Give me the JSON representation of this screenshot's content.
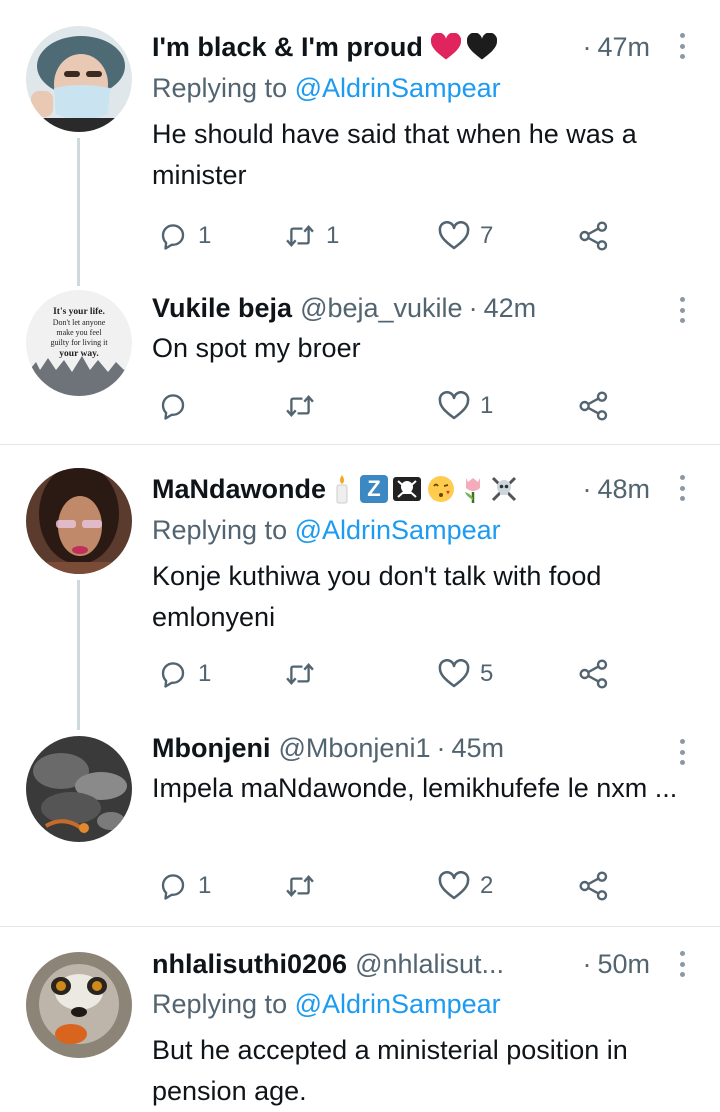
{
  "tweets": [
    {
      "name": "I'm black & I'm proud",
      "handle": "",
      "time": "47m",
      "replying_label": "Replying to",
      "replying_to": "@AldrinSampear",
      "text": "He should have said that when he was a minister",
      "replies": "1",
      "retweets": "1",
      "likes": "7"
    },
    {
      "name": "Vukile beja",
      "handle": "@beja_vukile",
      "time": "42m",
      "text": "On spot my broer",
      "replies": "",
      "retweets": "",
      "likes": "1",
      "avatar_text": [
        "It's your life.",
        "Don't let anyone",
        "make you feel",
        "guilty for living it",
        "your way."
      ]
    },
    {
      "name": "MaNdawonde",
      "handle": "",
      "time": "48m",
      "badge_letter": "Z",
      "replying_label": "Replying to",
      "replying_to": "@AldrinSampear",
      "text": "Konje kuthiwa you don't talk with food emlonyeni",
      "replies": "1",
      "retweets": "",
      "likes": "5"
    },
    {
      "name": "Mbonjeni",
      "handle": "@Mbonjeni1",
      "time": "45m",
      "text": "Impela maNdawonde, lemikhufefe le nxm ...",
      "replies": "1",
      "retweets": "",
      "likes": "2"
    },
    {
      "name": "nhlalisuthi0206",
      "handle": "@nhlalisut...",
      "time": "50m",
      "replying_label": "Replying to",
      "replying_to": "@AldrinSampear",
      "text": "But he accepted a ministerial position in pension age."
    }
  ],
  "dot_separator": "·",
  "icons": [
    "reply-icon",
    "retweet-icon",
    "like-icon",
    "share-icon",
    "more-icon"
  ],
  "colors": {
    "text": "#0f1419",
    "secondary": "#536471",
    "link": "#1d9bf0",
    "heart": "#e0245e"
  }
}
